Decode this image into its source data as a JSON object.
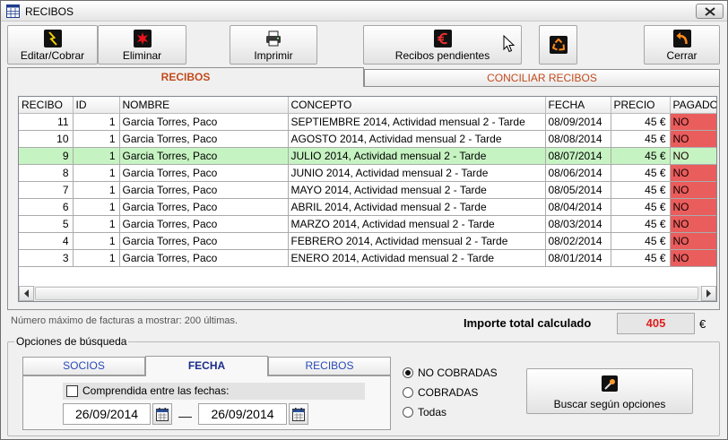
{
  "window": {
    "title": "RECIBOS",
    "icon": "app-table-icon",
    "close_icon": "close-icon"
  },
  "toolbar": {
    "edit": {
      "label": "Editar/Cobrar",
      "icon": "lightning-icon"
    },
    "delete": {
      "label": "Eliminar",
      "icon": "delete-burst-icon"
    },
    "print": {
      "label": "Imprimir",
      "icon": "printer-icon"
    },
    "pending": {
      "label": "Recibos pendientes",
      "icon": "euro-icon"
    },
    "refresh": {
      "icon": "recycle-icon"
    },
    "close": {
      "label": "Cerrar",
      "icon": "exit-arrow-icon"
    }
  },
  "tabs": [
    {
      "label": "RECIBOS",
      "active": true
    },
    {
      "label": "CONCILIAR RECIBOS",
      "active": false
    }
  ],
  "table": {
    "columns": [
      "RECIBO",
      "ID",
      "NOMBRE",
      "CONCEPTO",
      "FECHA",
      "PRECIO",
      "PAGADO"
    ],
    "rows": [
      {
        "recibo": "11",
        "id": "1",
        "nombre": "Garcia Torres, Paco",
        "concepto": "SEPTIEMBRE 2014, Actividad mensual 2 - Tarde",
        "fecha": "08/09/2014",
        "precio": "45 €",
        "pagado": "NO",
        "highlighted": false
      },
      {
        "recibo": "10",
        "id": "1",
        "nombre": "Garcia Torres, Paco",
        "concepto": "AGOSTO 2014, Actividad mensual 2 - Tarde",
        "fecha": "08/08/2014",
        "precio": "45 €",
        "pagado": "NO",
        "highlighted": false
      },
      {
        "recibo": "9",
        "id": "1",
        "nombre": "Garcia Torres, Paco",
        "concepto": "JULIO 2014, Actividad mensual 2 - Tarde",
        "fecha": "08/07/2014",
        "precio": "45 €",
        "pagado": "NO",
        "highlighted": true
      },
      {
        "recibo": "8",
        "id": "1",
        "nombre": "Garcia Torres, Paco",
        "concepto": "JUNIO 2014, Actividad mensual 2 - Tarde",
        "fecha": "08/06/2014",
        "precio": "45 €",
        "pagado": "NO",
        "highlighted": false
      },
      {
        "recibo": "7",
        "id": "1",
        "nombre": "Garcia Torres, Paco",
        "concepto": "MAYO 2014, Actividad mensual 2 - Tarde",
        "fecha": "08/05/2014",
        "precio": "45 €",
        "pagado": "NO",
        "highlighted": false
      },
      {
        "recibo": "6",
        "id": "1",
        "nombre": "Garcia Torres, Paco",
        "concepto": "ABRIL 2014, Actividad mensual 2 - Tarde",
        "fecha": "08/04/2014",
        "precio": "45 €",
        "pagado": "NO",
        "highlighted": false
      },
      {
        "recibo": "5",
        "id": "1",
        "nombre": "Garcia Torres, Paco",
        "concepto": "MARZO 2014, Actividad mensual 2 - Tarde",
        "fecha": "08/03/2014",
        "precio": "45 €",
        "pagado": "NO",
        "highlighted": false
      },
      {
        "recibo": "4",
        "id": "1",
        "nombre": "Garcia Torres, Paco",
        "concepto": "FEBRERO 2014, Actividad mensual 2 - Tarde",
        "fecha": "08/02/2014",
        "precio": "45 €",
        "pagado": "NO",
        "highlighted": false
      },
      {
        "recibo": "3",
        "id": "1",
        "nombre": "Garcia Torres, Paco",
        "concepto": "ENERO 2014, Actividad mensual 2 - Tarde",
        "fecha": "08/01/2014",
        "precio": "45 €",
        "pagado": "NO",
        "highlighted": false
      }
    ]
  },
  "summary": {
    "max_note": "Número máximo de facturas a mostrar: 200 últimas.",
    "total_label": "Importe total calculado",
    "total_value": "405",
    "currency": "€"
  },
  "search": {
    "title": "Opciones de búsqueda",
    "tabs": [
      {
        "label": "SOCIOS",
        "active": false
      },
      {
        "label": "FECHA",
        "active": true
      },
      {
        "label": "RECIBOS",
        "active": false
      }
    ],
    "date_range": {
      "label": "Comprendida entre las fechas:",
      "checked": false,
      "from": "26/09/2014",
      "to": "26/09/2014",
      "calendar_icon": "calendar-icon"
    },
    "status_options": [
      {
        "label": "NO COBRADAS",
        "selected": true
      },
      {
        "label": "COBRADAS",
        "selected": false
      },
      {
        "label": "Todas",
        "selected": false
      }
    ],
    "button": {
      "label": "Buscar según opciones",
      "icon": "magic-wand-icon"
    }
  },
  "colors": {
    "unpaid": "#e95d5d",
    "highlight": "#c6f3c2",
    "accent": "#c24a1c",
    "totalValue": "#e01e1e",
    "link": "#2a48b8"
  }
}
